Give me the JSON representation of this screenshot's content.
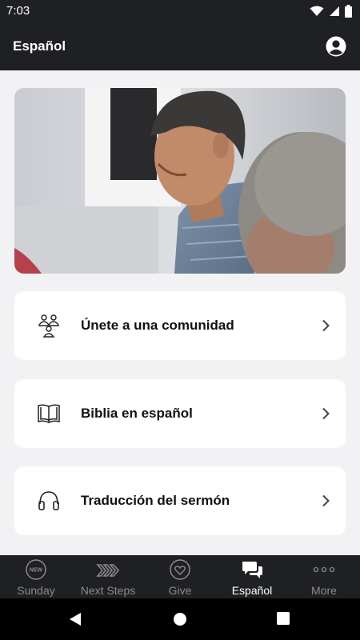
{
  "status_bar": {
    "time": "7:03"
  },
  "header": {
    "title": "Español"
  },
  "cards": [
    {
      "label": "Únete a una comunidad",
      "icon": "community-icon"
    },
    {
      "label": "Biblia en español",
      "icon": "book-icon"
    },
    {
      "label": "Traducción del sermón",
      "icon": "headphones-icon"
    }
  ],
  "tabs": [
    {
      "label": "Sunday",
      "icon": "new-badge-icon",
      "active": false,
      "badge": "NEW"
    },
    {
      "label": "Next Steps",
      "icon": "triple-chevron-icon",
      "active": false
    },
    {
      "label": "Give",
      "icon": "heart-icon",
      "active": false
    },
    {
      "label": "Español",
      "icon": "chat-bubbles-icon",
      "active": true
    },
    {
      "label": "More",
      "icon": "more-dots-icon",
      "active": false
    }
  ],
  "colors": {
    "header_bg": "#1f2023",
    "content_bg": "#f2f2f4",
    "inactive_tab": "#8b8b8f",
    "active_tab": "#ffffff"
  }
}
